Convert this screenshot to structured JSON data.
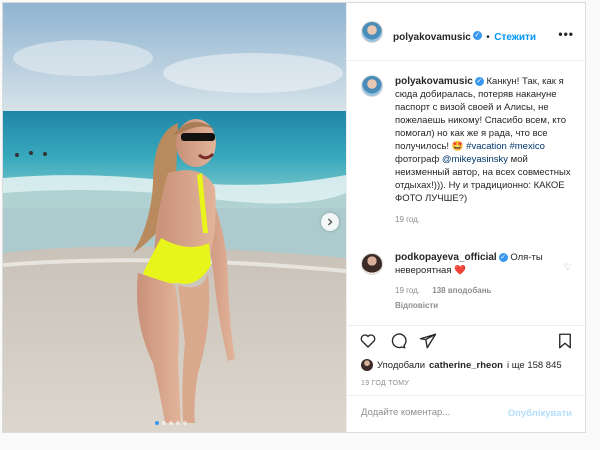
{
  "post": {
    "author": {
      "username": "polyakovamusic",
      "follow_label": "Стежити",
      "verified": true
    },
    "caption": {
      "username": "polyakovamusic",
      "text_before": "Канкун! Так, как я сюда добиралась, потеряв накануне паспорт с визой своей и Алисы, не пожелаешь никому! Спасибо всем, кто помогал) но как же я рада, что все получилось! ",
      "emoji": "🤩",
      "hashtag1": "#vacation",
      "hashtag2": "#mexico",
      "text_mid": " фотограф ",
      "mention": "@mikeyasinsky",
      "text_after": " мой неизменный автор, на всех совместных отдыхах!))). Ну и традиционно: КАКОЕ ФОТО ЛУЧШЕ?)",
      "time": "19 год."
    },
    "comment": {
      "username": "podkopayeva_official",
      "text": "Оля-ты невероятная",
      "emoji": "❤️",
      "time": "19 год.",
      "likes": "138 вподобань",
      "reply": "Відповісти"
    },
    "likes": {
      "prefix": "Уподобали",
      "user": "catherine_rheon",
      "suffix": "і ще 158 845"
    },
    "post_time": "19 ГОД ТОМУ",
    "add_comment": {
      "placeholder": "Додайте коментар...",
      "publish_label": "Опублікувати"
    },
    "carousel": {
      "slides": 5,
      "active": 1
    },
    "colors": {
      "accent": "#0095f6",
      "swimsuit": "#e8f51a",
      "sea": "#2f8fb0"
    }
  },
  "icons": [
    "more-icon",
    "heart-icon",
    "comment-icon",
    "share-icon",
    "bookmark-icon",
    "chevron-right-icon",
    "verified-icon"
  ]
}
